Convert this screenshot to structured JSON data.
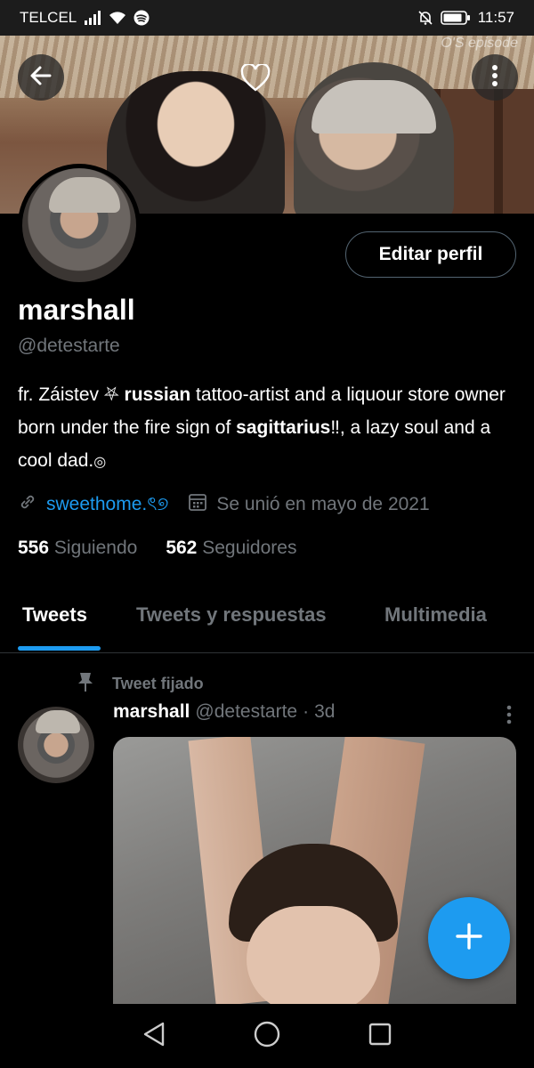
{
  "status_bar": {
    "carrier": "TELCEL",
    "time": "11:57",
    "icons": [
      "signal-icon",
      "wifi-icon",
      "spotify-icon",
      "mute-icon",
      "battery-icon"
    ]
  },
  "header": {
    "watermark": "O'S episode",
    "back_icon": "arrow-left-icon",
    "heart_icon": "heart-icon",
    "menu_icon": "more-vert-icon"
  },
  "profile": {
    "edit_button_label": "Editar perfil",
    "name": "marshall",
    "handle": "@detestarte",
    "bio": {
      "part1": "fr. Záistev ",
      "symbol1": "⛧",
      "part2": " ",
      "bold1": "russian",
      "part3": " tattoo-artist and a liquour store owner born under the fire sign of ",
      "bold2": "sagittarius",
      "part4": "‼, a lazy soul and a cool dad.",
      "symbol2": "◎"
    },
    "link": "sweethome.ৎ୭",
    "joined": "Se unió en mayo de 2021",
    "following_count": "556",
    "following_label": "Siguiendo",
    "followers_count": "562",
    "followers_label": "Seguidores"
  },
  "tabs": [
    {
      "label": "Tweets",
      "active": true
    },
    {
      "label": "Tweets y respuestas",
      "active": false
    },
    {
      "label": "Multimedia",
      "active": false
    }
  ],
  "pinned_tweet": {
    "pinned_label": "Tweet fijado",
    "author_name": "marshall",
    "author_handle": "@detestarte",
    "separator": "·",
    "time": "3d"
  },
  "colors": {
    "accent": "#1d9bf0",
    "background": "#000000",
    "muted_text": "#71767b"
  }
}
